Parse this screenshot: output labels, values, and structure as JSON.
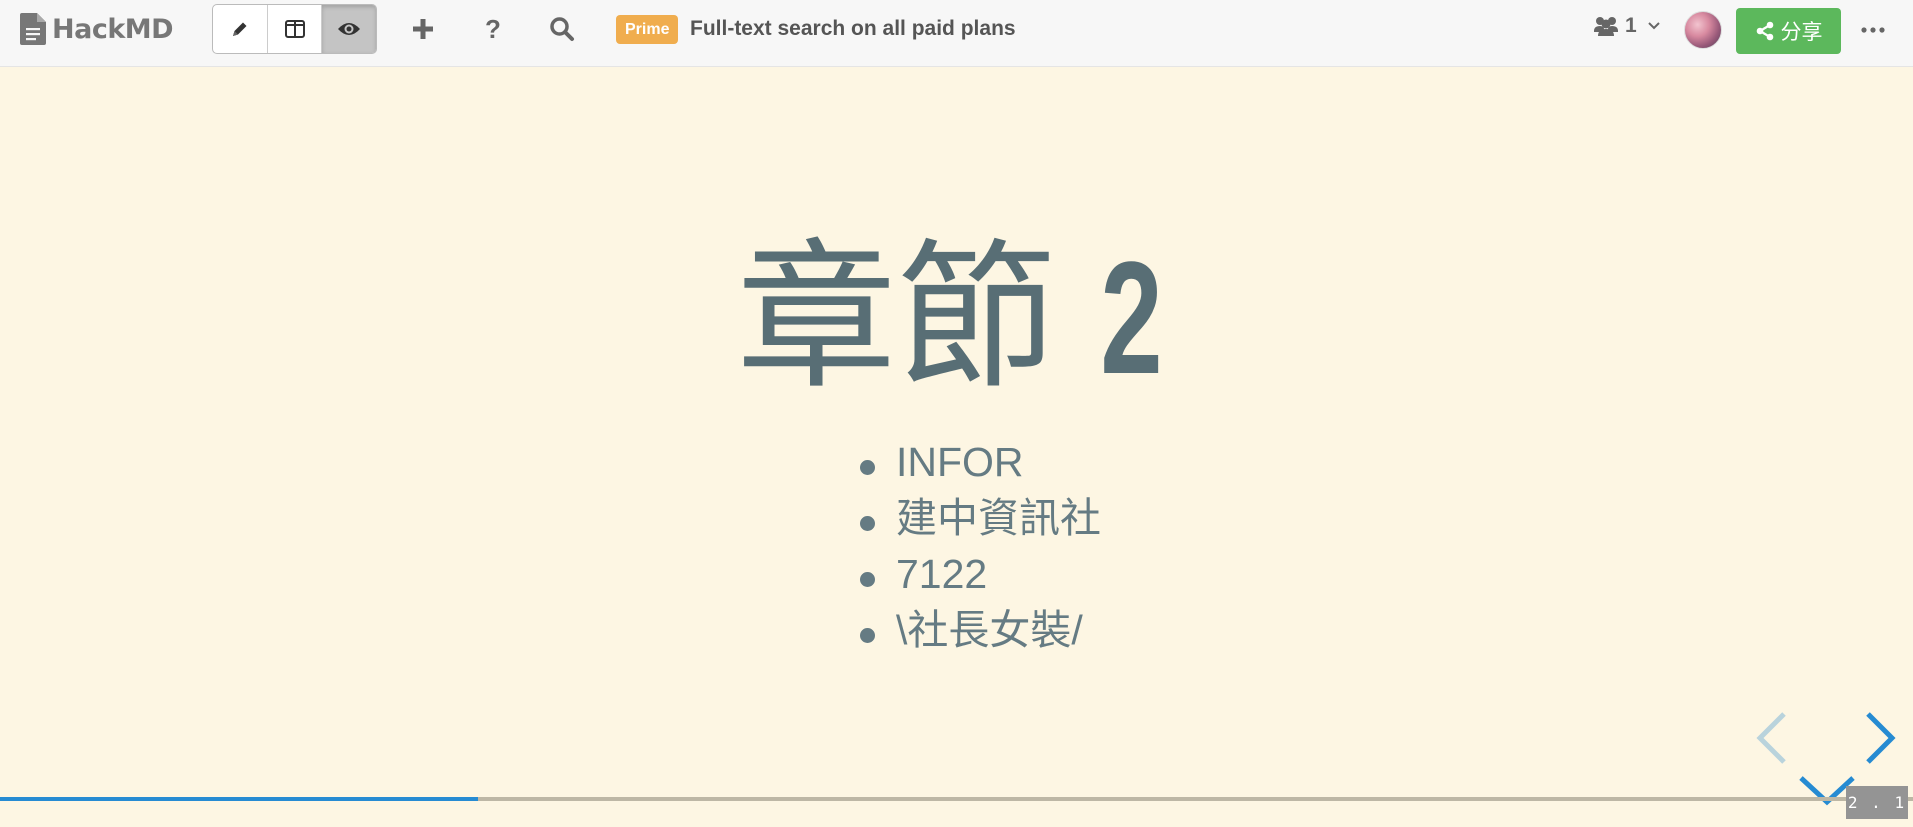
{
  "app": {
    "brand": "HackMD"
  },
  "toolbar": {
    "modes": [
      {
        "name": "edit",
        "icon": "pencil-icon",
        "active": false
      },
      {
        "name": "both",
        "icon": "columns-icon",
        "active": false
      },
      {
        "name": "view",
        "icon": "eye-icon",
        "active": true
      }
    ],
    "new_icon": "plus-icon",
    "help_label": "?",
    "search_icon": "search-icon",
    "prime_badge": "Prime",
    "prime_text": "Full-text search on all paid plans",
    "online_count": "1",
    "share_label": "分享"
  },
  "slide": {
    "title_cjk": "章節",
    "title_num": "2",
    "items": [
      "INFOR",
      "建中資訊社",
      "7122",
      "\\社長女裝/"
    ]
  },
  "controls": {
    "progress_fraction": 0.25,
    "slide_number": "2 . 1",
    "progress_color": "#268bd2",
    "arrow_color": "#268bd2"
  }
}
